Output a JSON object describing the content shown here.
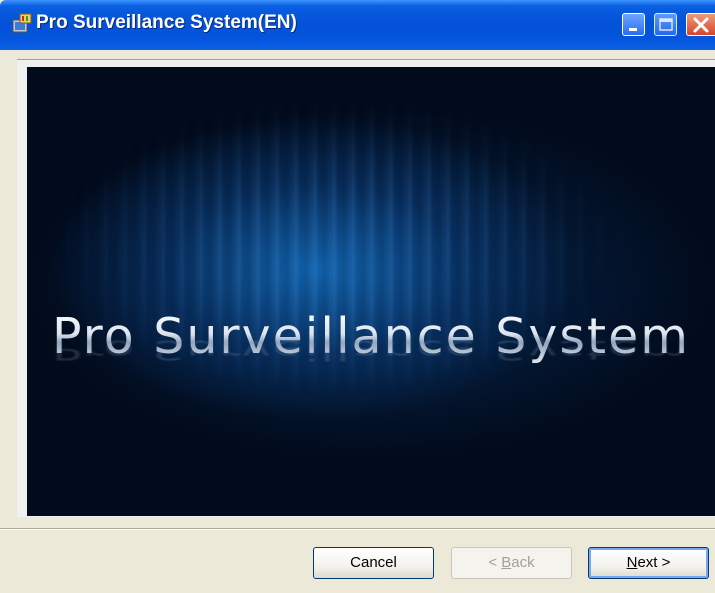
{
  "window": {
    "title": "Pro Surveillance System(EN)",
    "icon": "installer-icon"
  },
  "banner": {
    "title": "Pro Surveillance System"
  },
  "buttons": {
    "cancel": "Cancel",
    "back_prefix": "< ",
    "back_hotkey": "B",
    "back_rest": "ack",
    "next_hotkey": "N",
    "next_rest": "ext >"
  },
  "colors": {
    "titlebar": "#0452d8",
    "banner_background": "#000510",
    "close_button": "#d6452a"
  }
}
